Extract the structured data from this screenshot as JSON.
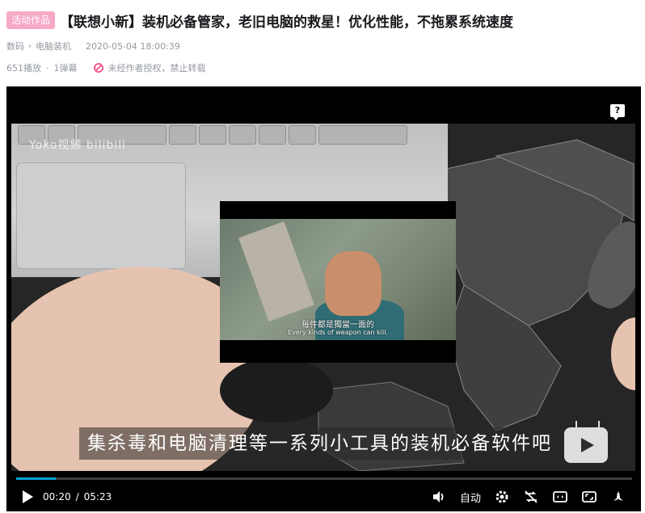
{
  "header": {
    "badge": "活动作品",
    "title": "【联想小新】装机必备管家，老旧电脑的救星！优化性能，不拖累系统速度"
  },
  "meta": {
    "category": "数码",
    "subcategory": "电脑装机",
    "timestamp": "2020-05-04 18:00:39"
  },
  "stats": {
    "plays": "651播放",
    "danmaku": "1弹幕",
    "notice": "未经作者授权，禁止转载"
  },
  "player": {
    "help_label": "?",
    "watermark": "Yoko视频 bilibili",
    "inset_subtitle_cn": "每件都是獨當一面的",
    "inset_subtitle_en": "Every kinds of weapon can kill.",
    "subtitle": "集杀毒和电脑清理等一系列小工具的装机必备软件吧",
    "progress_fraction": 0.064,
    "current_time": "00:20",
    "time_separator": "/",
    "duration": "05:23",
    "quality_label": "自动",
    "accent_color": "#00a1d6",
    "icons": [
      "play-icon",
      "volume-icon",
      "settings-icon",
      "loop-off-icon",
      "widescreen-icon",
      "web-fullscreen-icon",
      "fullscreen-icon"
    ]
  }
}
